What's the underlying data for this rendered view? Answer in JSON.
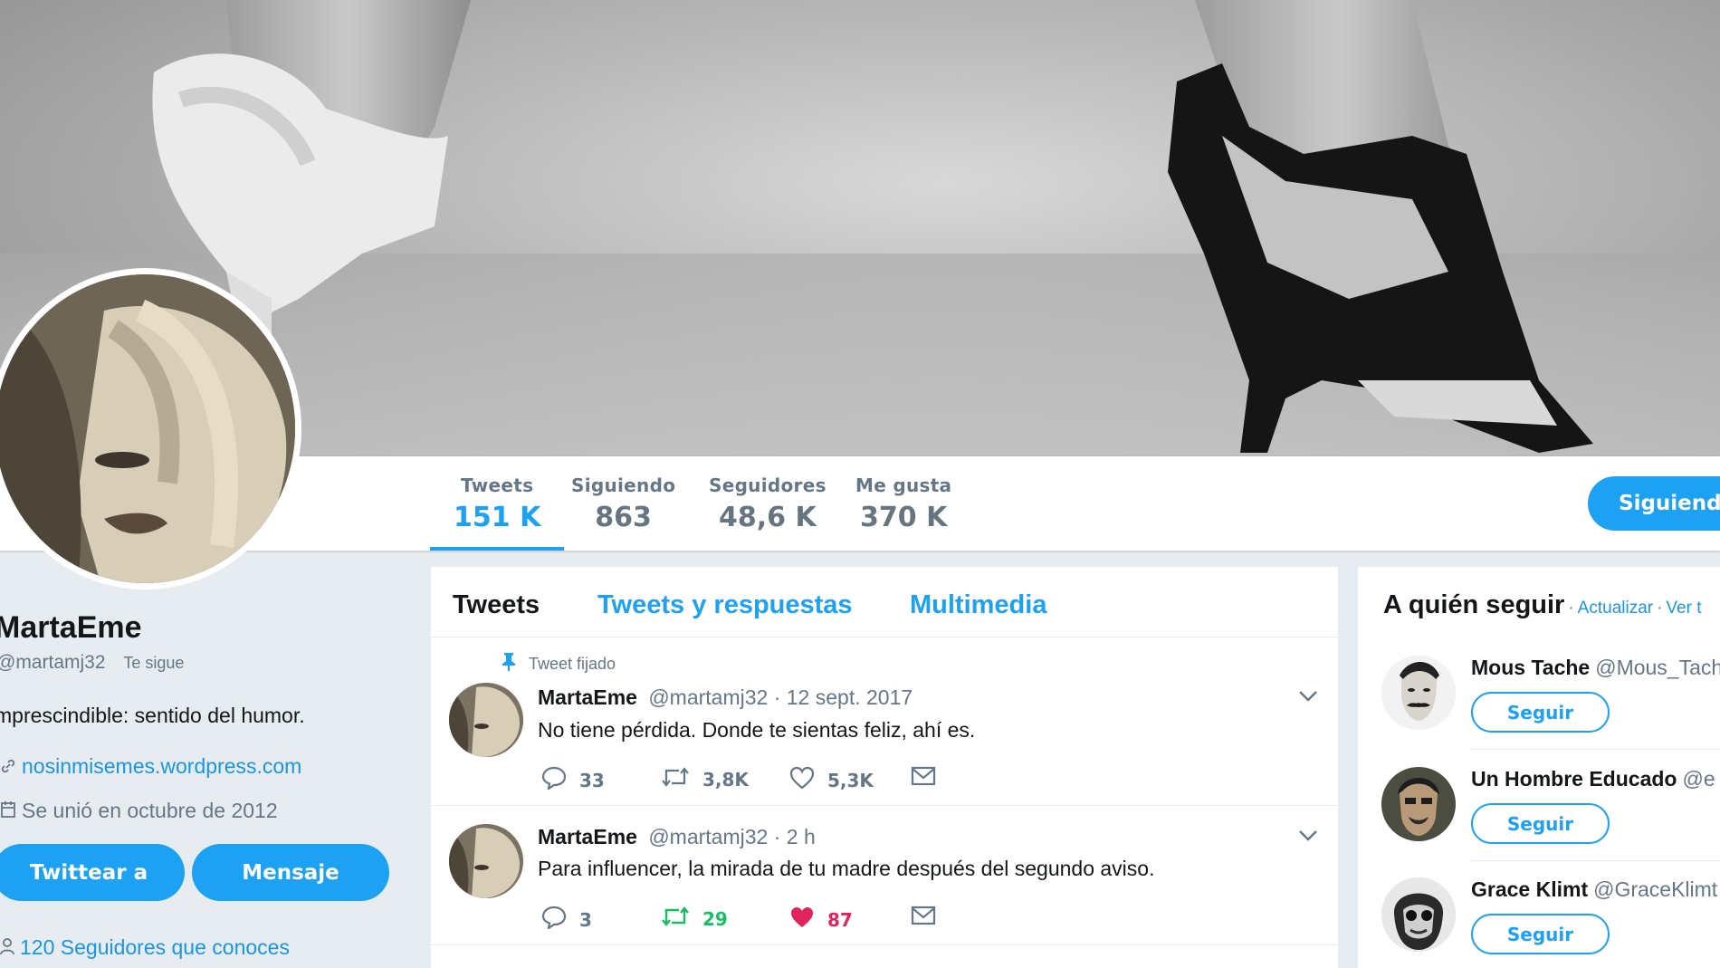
{
  "stats": [
    {
      "label": "Tweets",
      "value": "151 K"
    },
    {
      "label": "Siguiendo",
      "value": "863"
    },
    {
      "label": "Seguidores",
      "value": "48,6 K"
    },
    {
      "label": "Me gusta",
      "value": "370 K"
    }
  ],
  "follow_button": "Siguiendo",
  "profile": {
    "name": "MartaEme",
    "handle": "@martamj32",
    "follows_you": "Te sigue",
    "bio": "mprescindible: sentido del humor.",
    "link": "nosinmisemes.wordpress.com",
    "joined": "Se unió en octubre de 2012",
    "tweet_to_button": "Twittear a",
    "message_button": "Mensaje",
    "followers_you_know": "120 Seguidores que conoces"
  },
  "tabs": [
    "Tweets",
    "Tweets y respuestas",
    "Multimedia"
  ],
  "pinned_label": "Tweet fijado",
  "tweets": [
    {
      "name": "MartaEme",
      "handle": "@martamj32",
      "time": "· 12 sept. 2017",
      "text": "No tiene pérdida. Donde te sientas feliz, ahí es.",
      "replies": "33",
      "retweets": "3,8K",
      "likes": "5,3K"
    },
    {
      "name": "MartaEme",
      "handle": "@martamj32",
      "time": "· 2 h",
      "text": "Para influencer, la mirada de tu madre después del segundo aviso.",
      "replies": "3",
      "retweets": "29",
      "likes": "87"
    }
  ],
  "who_to_follow": {
    "title": "A quién seguir",
    "refresh": "Actualizar",
    "view_all": "Ver t",
    "follow_label": "Seguir",
    "suggestions": [
      {
        "name": "Mous Tache",
        "handle": "@Mous_Tach"
      },
      {
        "name": "Un Hombre Educado",
        "handle": "@e"
      },
      {
        "name": "Grace Klimt",
        "handle": "@GraceKlimt"
      }
    ]
  },
  "colors": {
    "accent": "#1da1f2",
    "retweet_active": "#17bf63",
    "like_active": "#e0245e",
    "background": "#e6ecf0"
  }
}
